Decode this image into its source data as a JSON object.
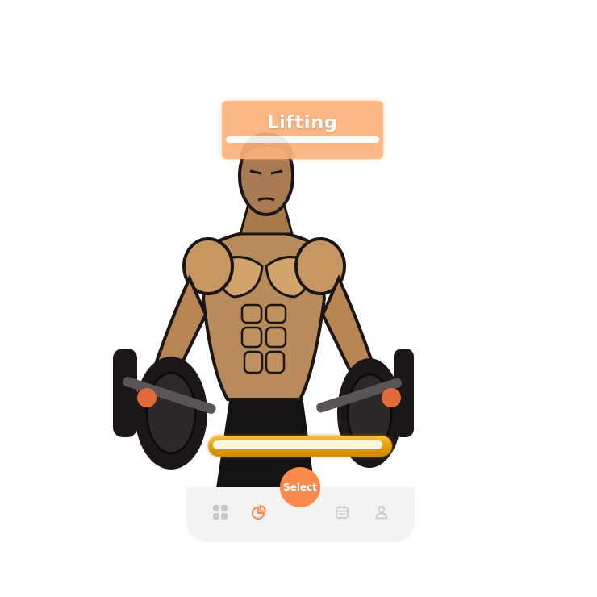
{
  "header": {
    "title": "Lifting"
  },
  "workout_progress": {
    "fraction": 0.97
  },
  "bottom_nav": {
    "items": [
      {
        "icon": "grid-icon",
        "active": false
      },
      {
        "icon": "chart-pie-icon",
        "active": true
      },
      {
        "icon": "calendar-icon",
        "active": false
      },
      {
        "icon": "user-icon",
        "active": false
      }
    ],
    "select_label": "Select"
  },
  "colors": {
    "accent": "#fa8a4b",
    "banner": "#fcb27a",
    "progress": "#e7a20b",
    "icon_inactive": "#c9c7c8",
    "nav_bg": "#f4f2f3"
  }
}
